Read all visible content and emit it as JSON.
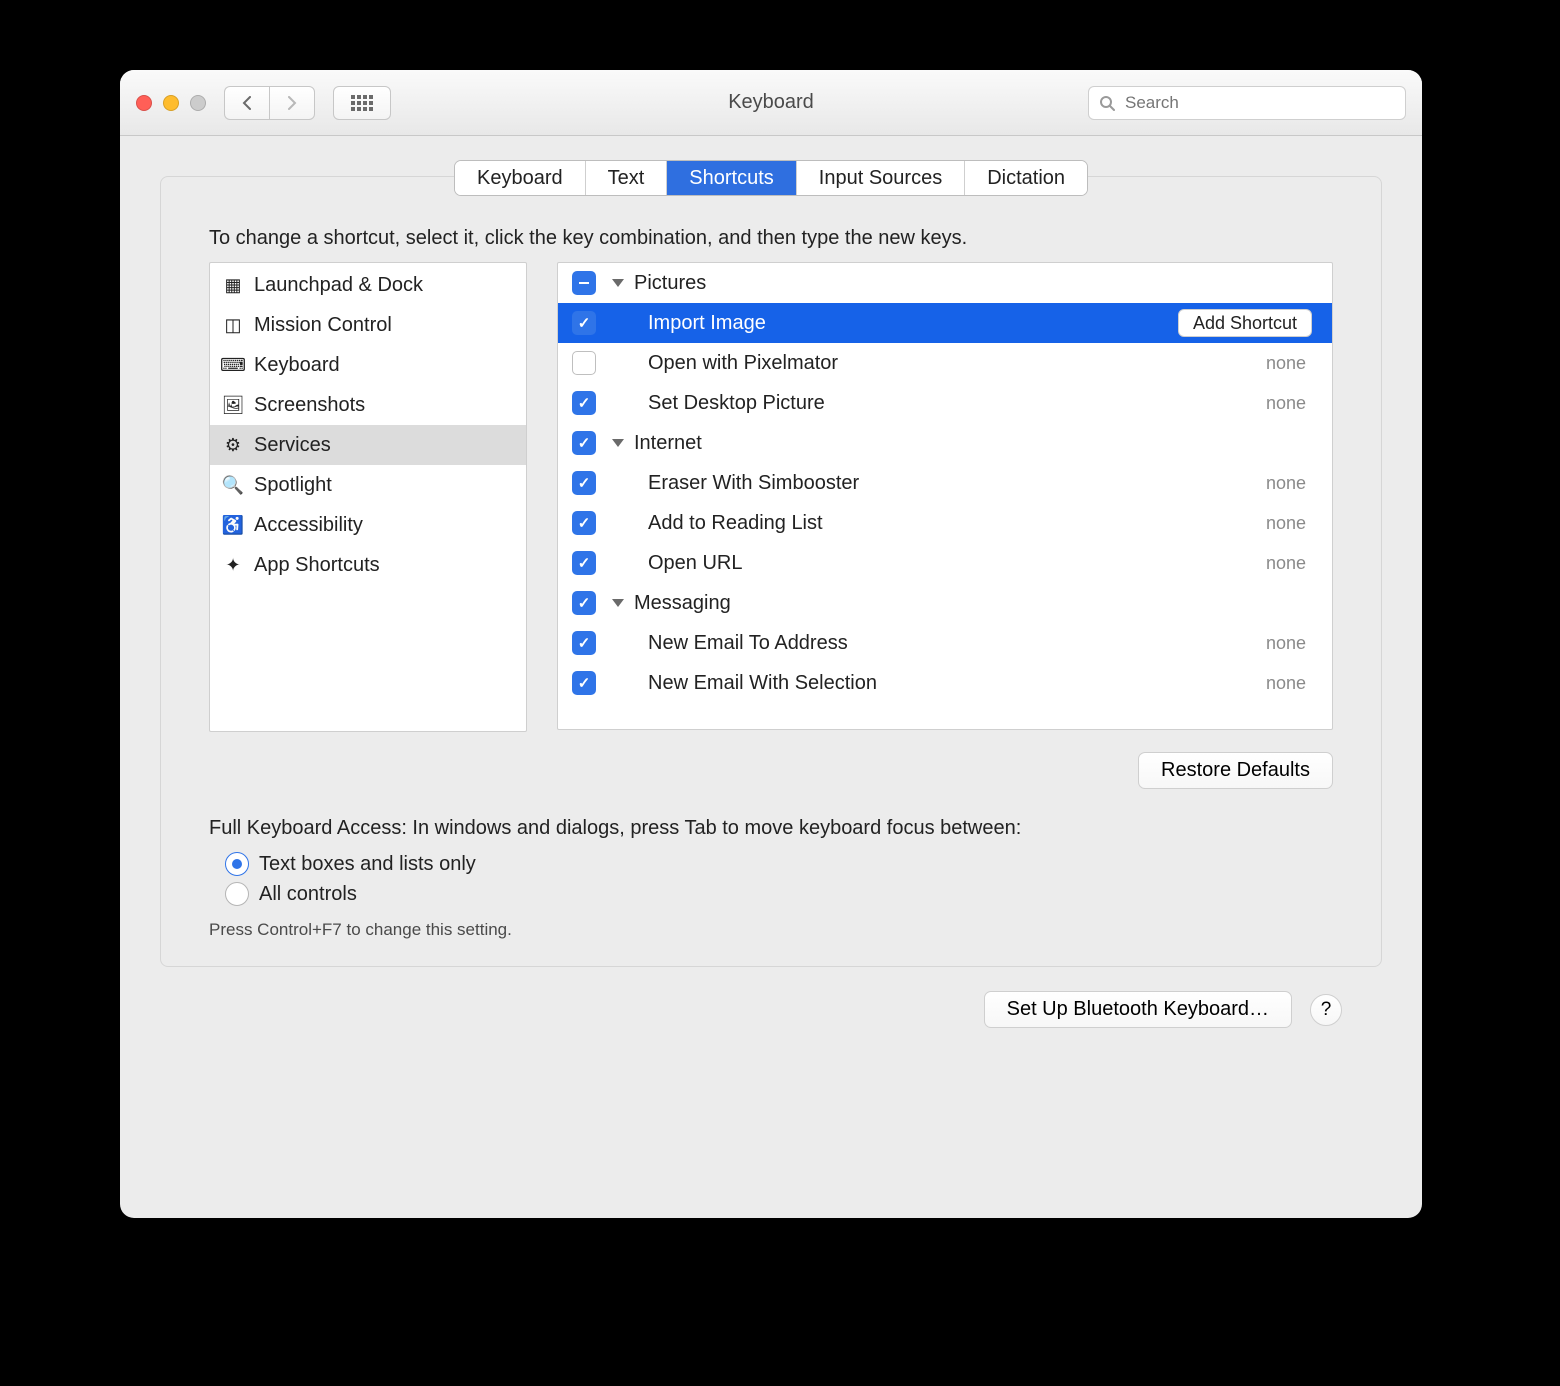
{
  "window": {
    "title": "Keyboard"
  },
  "toolbar": {
    "search_placeholder": "Search"
  },
  "tabs": [
    {
      "label": "Keyboard",
      "active": false
    },
    {
      "label": "Text",
      "active": false
    },
    {
      "label": "Shortcuts",
      "active": true
    },
    {
      "label": "Input Sources",
      "active": false
    },
    {
      "label": "Dictation",
      "active": false
    }
  ],
  "instruction": "To change a shortcut, select it, click the key combination, and then type the new keys.",
  "sidebar": {
    "items": [
      {
        "label": "Launchpad & Dock",
        "icon": "launchpad-icon",
        "glyph": "▦"
      },
      {
        "label": "Mission Control",
        "icon": "mission-control-icon",
        "glyph": "◫"
      },
      {
        "label": "Keyboard",
        "icon": "keyboard-icon",
        "glyph": "⌨"
      },
      {
        "label": "Screenshots",
        "icon": "screenshots-icon",
        "glyph": "🖼"
      },
      {
        "label": "Services",
        "icon": "services-icon",
        "glyph": "⚙"
      },
      {
        "label": "Spotlight",
        "icon": "spotlight-icon",
        "glyph": "🔍"
      },
      {
        "label": "Accessibility",
        "icon": "accessibility-icon",
        "glyph": "♿"
      },
      {
        "label": "App Shortcuts",
        "icon": "app-shortcuts-icon",
        "glyph": "✦"
      }
    ],
    "selected_index": 4
  },
  "tree": {
    "add_shortcut_label": "Add Shortcut",
    "groups": [
      {
        "label": "Pictures",
        "checked": "mixed",
        "items": [
          {
            "label": "Import Image",
            "checked": true,
            "shortcut": null,
            "selected": true
          },
          {
            "label": "Open with Pixelmator",
            "checked": false,
            "shortcut": "none"
          },
          {
            "label": "Set Desktop Picture",
            "checked": true,
            "shortcut": "none"
          }
        ]
      },
      {
        "label": "Internet",
        "checked": true,
        "items": [
          {
            "label": "Eraser With Simbooster",
            "checked": true,
            "shortcut": "none"
          },
          {
            "label": "Add to Reading List",
            "checked": true,
            "shortcut": "none"
          },
          {
            "label": "Open URL",
            "checked": true,
            "shortcut": "none"
          }
        ]
      },
      {
        "label": "Messaging",
        "checked": true,
        "items": [
          {
            "label": "New Email To Address",
            "checked": true,
            "shortcut": "none"
          },
          {
            "label": "New Email With Selection",
            "checked": true,
            "shortcut": "none"
          }
        ]
      }
    ]
  },
  "buttons": {
    "restore_defaults": "Restore Defaults",
    "setup_bluetooth": "Set Up Bluetooth Keyboard…",
    "help": "?"
  },
  "full_keyboard_access": {
    "heading": "Full Keyboard Access: In windows and dialogs, press Tab to move keyboard focus between:",
    "options": [
      {
        "label": "Text boxes and lists only",
        "checked": true
      },
      {
        "label": "All controls",
        "checked": false
      }
    ],
    "hint": "Press Control+F7 to change this setting."
  }
}
